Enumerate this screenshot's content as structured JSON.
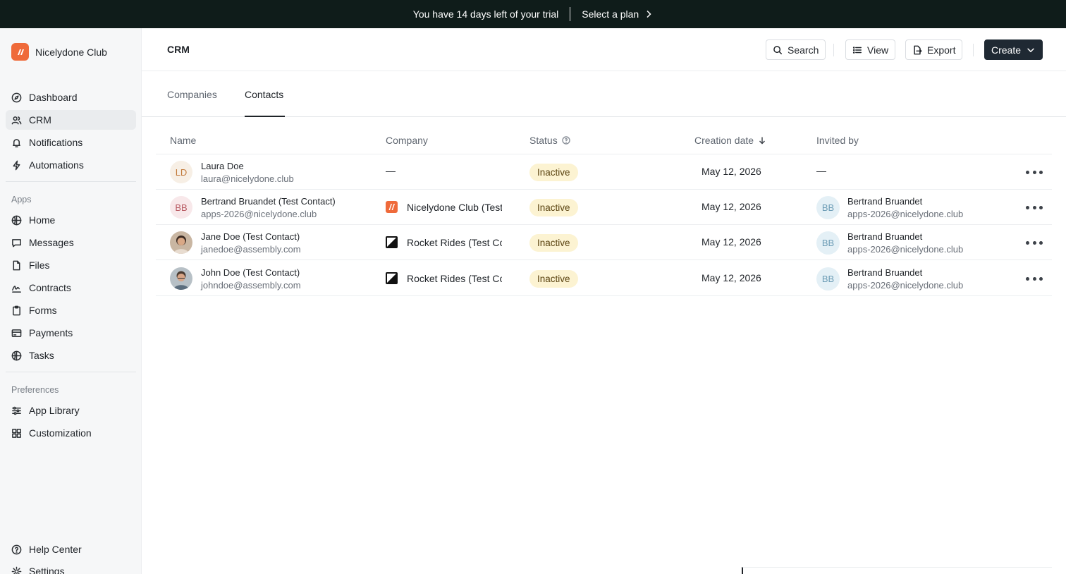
{
  "banner": {
    "text": "You have 14 days left of your trial",
    "cta": "Select a plan"
  },
  "sidebar": {
    "org_name": "Nicelydone Club",
    "main_items": [
      {
        "label": "Dashboard",
        "icon": "compass-icon"
      },
      {
        "label": "CRM",
        "icon": "users-icon",
        "active": true
      },
      {
        "label": "Notifications",
        "icon": "bell-icon"
      },
      {
        "label": "Automations",
        "icon": "bolt-icon"
      }
    ],
    "apps_label": "Apps",
    "app_items": [
      {
        "label": "Home",
        "icon": "globe-icon"
      },
      {
        "label": "Messages",
        "icon": "message-icon"
      },
      {
        "label": "Files",
        "icon": "file-icon"
      },
      {
        "label": "Contracts",
        "icon": "signature-icon"
      },
      {
        "label": "Forms",
        "icon": "clipboard-icon"
      },
      {
        "label": "Payments",
        "icon": "card-icon"
      },
      {
        "label": "Tasks",
        "icon": "globe-icon"
      }
    ],
    "prefs_label": "Preferences",
    "pref_items": [
      {
        "label": "App Library",
        "icon": "sliders-icon"
      },
      {
        "label": "Customization",
        "icon": "grid-icon"
      }
    ],
    "footer_items": [
      {
        "label": "Help Center",
        "icon": "help-icon"
      },
      {
        "label": "Settings",
        "icon": "gear-icon"
      }
    ]
  },
  "header": {
    "title": "CRM",
    "search_label": "Search",
    "view_label": "View",
    "export_label": "Export",
    "create_label": "Create"
  },
  "tabs": [
    {
      "label": "Companies"
    },
    {
      "label": "Contacts",
      "active": true
    }
  ],
  "table": {
    "columns": {
      "name": "Name",
      "company": "Company",
      "status": "Status",
      "creation_date": "Creation date",
      "invited_by": "Invited by"
    },
    "rows": [
      {
        "initials": "LD",
        "name": "Laura Doe",
        "email": "laura@nicelydone.club",
        "company": "—",
        "status": "Inactive",
        "date": "May 12, 2026",
        "invited_by": "—"
      },
      {
        "initials": "BB",
        "name": "Bertrand Bruandet (Test Contact)",
        "email": "apps-2026@nicelydone.club",
        "company": "Nicelydone Club (Test",
        "status": "Inactive",
        "date": "May 12, 2026",
        "invited_initials": "BB",
        "invited_name": "Bertrand Bruandet",
        "invited_email": "apps-2026@nicelydone.club"
      },
      {
        "name": "Jane Doe (Test Contact)",
        "email": "janedoe@assembly.com",
        "company": "Rocket Rides (Test Co",
        "status": "Inactive",
        "date": "May 12, 2026",
        "invited_initials": "BB",
        "invited_name": "Bertrand Bruandet",
        "invited_email": "apps-2026@nicelydone.club"
      },
      {
        "name": "John Doe (Test Contact)",
        "email": "johndoe@assembly.com",
        "company": "Rocket Rides (Test Co",
        "status": "Inactive",
        "date": "May 12, 2026",
        "invited_initials": "BB",
        "invited_name": "Bertrand Bruandet",
        "invited_email": "apps-2026@nicelydone.club"
      }
    ]
  },
  "colors": {
    "banner_bg": "#0f1c1a",
    "brand": "#ef6a3a",
    "status_bg": "#fcf3d2",
    "primary_button": "#1f2933"
  }
}
